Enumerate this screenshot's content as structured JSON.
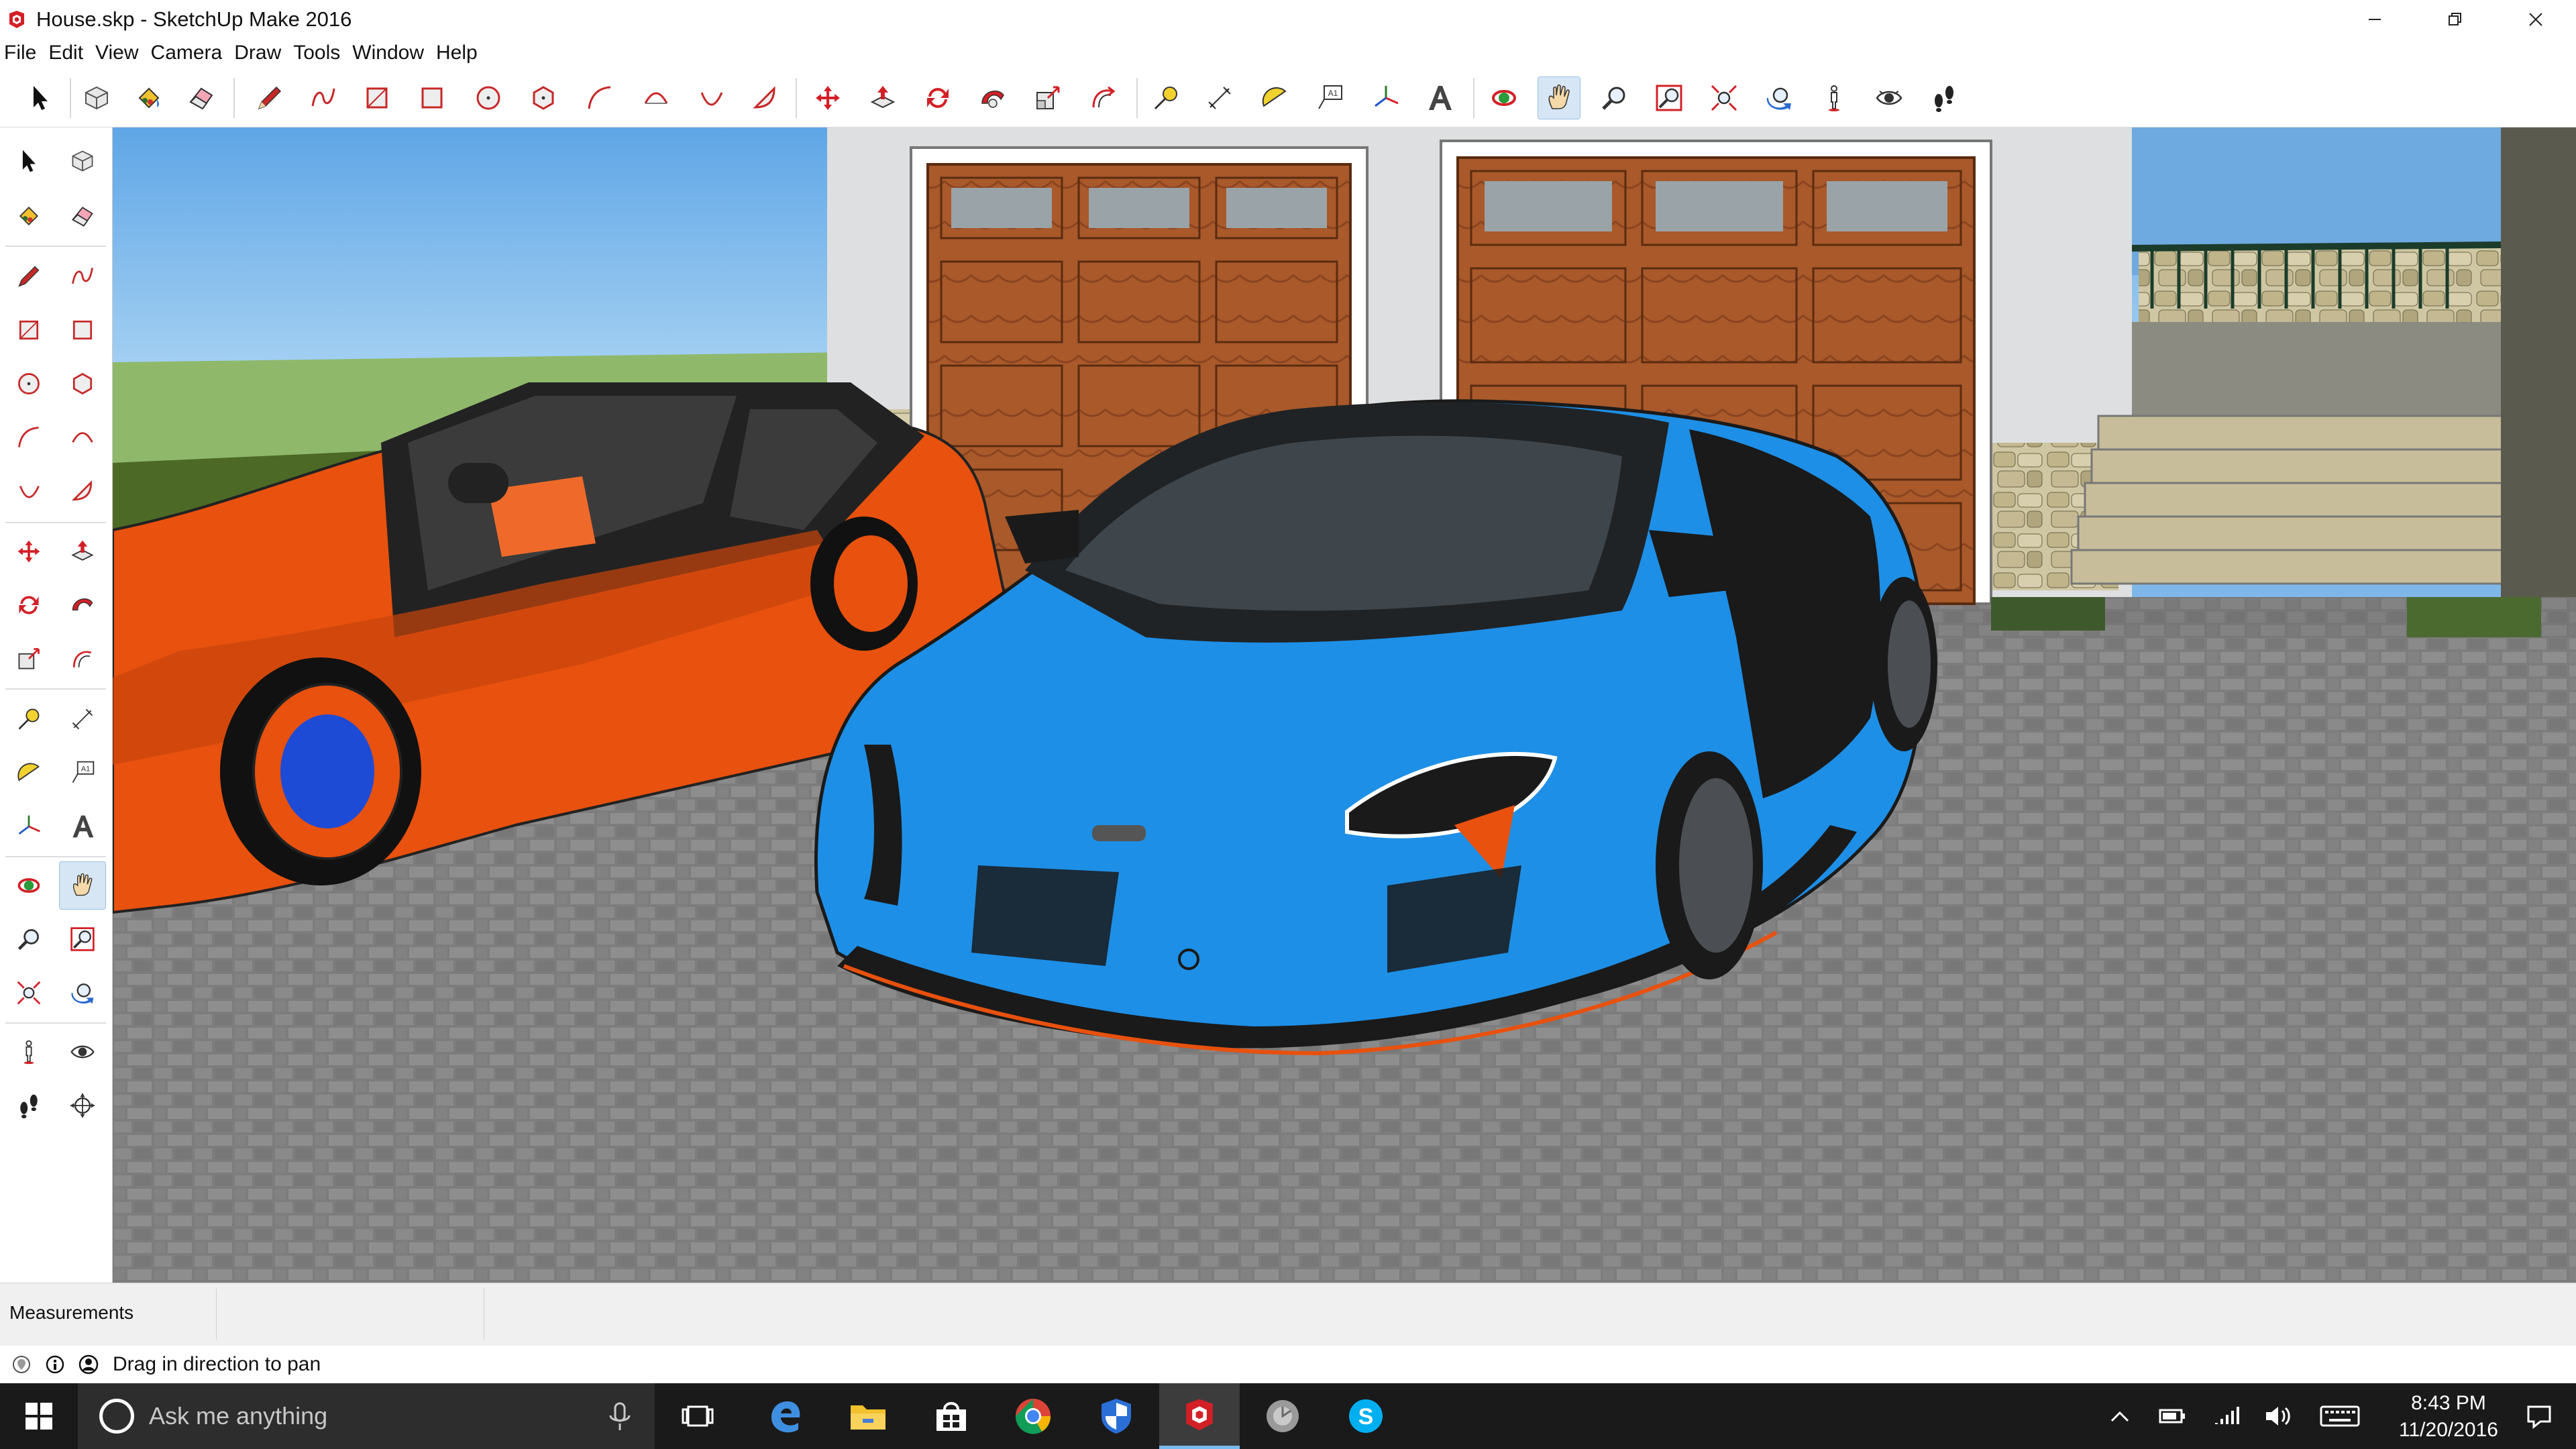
{
  "window": {
    "title": "House.skp - SketchUp Make 2016",
    "controls": [
      "minimize",
      "restore",
      "close"
    ]
  },
  "menu": [
    "File",
    "Edit",
    "View",
    "Camera",
    "Draw",
    "Tools",
    "Window",
    "Help"
  ],
  "toolbar": {
    "tools": [
      "select",
      "make-component",
      "paint-bucket",
      "eraser",
      "line",
      "freehand",
      "rectangle",
      "rotated-rectangle",
      "circle",
      "polygon",
      "arc",
      "two-point-arc",
      "three-point-arc",
      "pie",
      "move",
      "push-pull",
      "rotate",
      "follow-me",
      "scale",
      "offset",
      "tape-measure",
      "dimension",
      "protractor",
      "text",
      "axes",
      "3d-text",
      "orbit",
      "pan",
      "zoom",
      "zoom-window",
      "zoom-extents",
      "previous",
      "position-camera",
      "look-around",
      "walk"
    ],
    "active": "pan"
  },
  "left_toolbar": {
    "tools": [
      "select",
      "make-component",
      "paint-bucket",
      "eraser",
      "line",
      "freehand",
      "rectangle",
      "rotated-rectangle",
      "circle",
      "polygon",
      "arc",
      "two-point-arc",
      "three-point-arc",
      "pie",
      "move",
      "push-pull",
      "rotate",
      "follow-me",
      "scale",
      "offset",
      "tape-measure",
      "dimension",
      "protractor",
      "text",
      "axes",
      "3d-text",
      "orbit",
      "pan",
      "zoom",
      "zoom-window",
      "zoom-extents",
      "previous",
      "position-camera",
      "look-around",
      "walk",
      "section-plane"
    ],
    "active": "pan"
  },
  "viewport": {
    "scene_description": "3D model: blue sports car and orange sports car parked on brick driveway in front of a house with two wooden garage doors"
  },
  "measurements": {
    "label": "Measurements",
    "value": ""
  },
  "status": {
    "text": "Drag in direction to pan"
  },
  "taskbar": {
    "search_placeholder": "Ask me anything",
    "apps": [
      "task-view",
      "edge",
      "file-explorer",
      "store",
      "chrome",
      "defender",
      "sketchup",
      "app-gray",
      "skype"
    ],
    "active_app": "sketchup",
    "time": "8:43 PM",
    "date": "11/20/2016"
  },
  "colors": {
    "accent": "#76b9ed",
    "taskbar_bg": "#1a1a1a",
    "sky": "#7fb7e9",
    "blue_car": "#1e8fe6",
    "orange_car": "#e8510e"
  }
}
